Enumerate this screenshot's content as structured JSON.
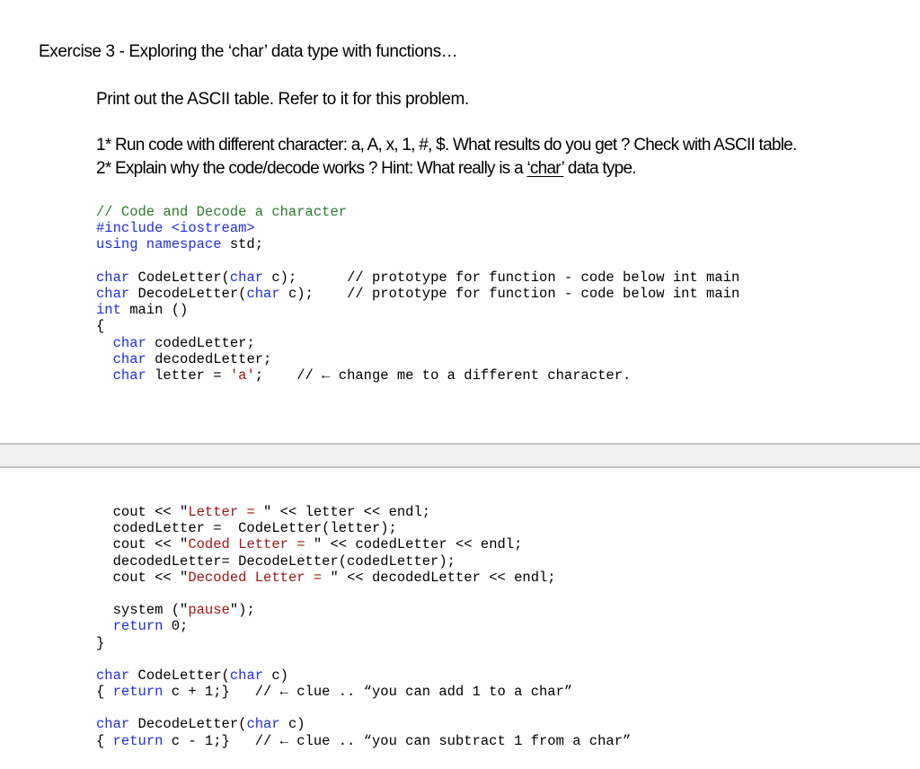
{
  "document": {
    "title": "Exercise 3  - Exploring the ‘char’ data type with functions…",
    "intro": "Print out the ASCII table. Refer to it for this problem.",
    "questions": {
      "q1": "1* Run code with different character:  a, A, x, 1, #, $. What results do you get ?  Check with ASCII table.",
      "q2_before": "2* Explain why the code/decode works ?  Hint: What really is a ",
      "q2_underlined": "‘char’",
      "q2_after": " data type."
    }
  },
  "code_top": [
    [
      [
        "cm",
        "// Code and Decode a character"
      ]
    ],
    [
      [
        "pp",
        "#include <iostream>"
      ]
    ],
    [
      [
        "kw",
        "using namespace"
      ],
      [
        "txt",
        " std;"
      ]
    ],
    [
      [
        "txt",
        ""
      ]
    ],
    [
      [
        "kw",
        "char"
      ],
      [
        "txt",
        " CodeLetter("
      ],
      [
        "kw",
        "char"
      ],
      [
        "txt",
        " c);      // prototype for function - code below int main"
      ]
    ],
    [
      [
        "kw",
        "char"
      ],
      [
        "txt",
        " DecodeLetter("
      ],
      [
        "kw",
        "char"
      ],
      [
        "txt",
        " c);    // prototype for function - code below int main"
      ]
    ],
    [
      [
        "kw",
        "int"
      ],
      [
        "txt",
        " main ()"
      ]
    ],
    [
      [
        "txt",
        "{"
      ]
    ],
    [
      [
        "txt",
        "  "
      ],
      [
        "kw",
        "char"
      ],
      [
        "txt",
        " codedLetter;"
      ]
    ],
    [
      [
        "txt",
        "  "
      ],
      [
        "kw",
        "char"
      ],
      [
        "txt",
        " decodedLetter;"
      ]
    ],
    [
      [
        "txt",
        "  "
      ],
      [
        "kw",
        "char"
      ],
      [
        "txt",
        " letter = "
      ],
      [
        "str",
        "'a'"
      ],
      [
        "txt",
        ";    // ← change me to a different character."
      ]
    ]
  ],
  "code_bottom": [
    [
      [
        "txt",
        "  cout << \""
      ],
      [
        "str",
        "Letter = "
      ],
      [
        "txt",
        "\" << letter << endl;"
      ]
    ],
    [
      [
        "txt",
        "  codedLetter =  CodeLetter(letter);"
      ]
    ],
    [
      [
        "txt",
        "  cout << \""
      ],
      [
        "str",
        "Coded Letter = "
      ],
      [
        "txt",
        "\" << codedLetter << endl;"
      ]
    ],
    [
      [
        "txt",
        "  decodedLetter= DecodeLetter(codedLetter);"
      ]
    ],
    [
      [
        "txt",
        "  cout << \""
      ],
      [
        "str",
        "Decoded Letter = "
      ],
      [
        "txt",
        "\" << decodedLetter << endl;"
      ]
    ],
    [
      [
        "txt",
        ""
      ]
    ],
    [
      [
        "txt",
        "  system (\""
      ],
      [
        "str",
        "pause"
      ],
      [
        "txt",
        "\");"
      ]
    ],
    [
      [
        "txt",
        "  "
      ],
      [
        "kw",
        "return"
      ],
      [
        "txt",
        " 0;"
      ]
    ],
    [
      [
        "txt",
        "}"
      ]
    ],
    [
      [
        "txt",
        ""
      ]
    ],
    [
      [
        "kw",
        "char"
      ],
      [
        "txt",
        " CodeLetter("
      ],
      [
        "kw",
        "char"
      ],
      [
        "txt",
        " c)"
      ]
    ],
    [
      [
        "txt",
        "{ "
      ],
      [
        "kw",
        "return"
      ],
      [
        "txt",
        " c + 1;}   // ← clue .. “you can add 1 to a char”"
      ]
    ],
    [
      [
        "txt",
        ""
      ]
    ],
    [
      [
        "kw",
        "char"
      ],
      [
        "txt",
        " DecodeLetter("
      ],
      [
        "kw",
        "char"
      ],
      [
        "txt",
        " c)"
      ]
    ],
    [
      [
        "txt",
        "{ "
      ],
      [
        "kw",
        "return"
      ],
      [
        "txt",
        " c - 1;}   // ← clue .. “you can subtract 1 from a char”"
      ]
    ]
  ],
  "colors": {
    "keyword": "#1f2fe0",
    "comment": "#2d7a2d",
    "string": "#a31515",
    "page_break_fill": "#f1f1f1",
    "page_break_border": "#bfc3c8"
  }
}
